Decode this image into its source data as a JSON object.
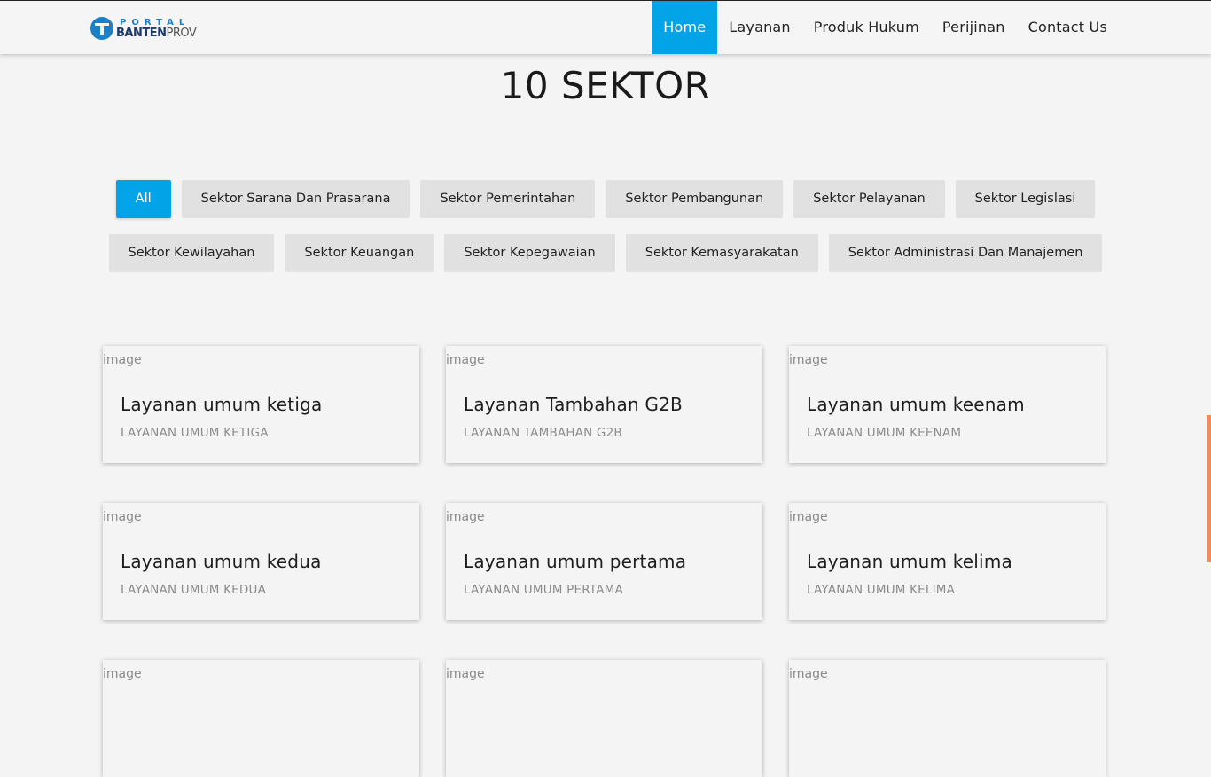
{
  "brand": {
    "top": "PORTAL",
    "bottom_bold": "BANTEN",
    "bottom_light": "PROV"
  },
  "nav": {
    "items": [
      {
        "label": "Home",
        "active": true
      },
      {
        "label": "Layanan"
      },
      {
        "label": "Produk Hukum"
      },
      {
        "label": "Perijinan"
      },
      {
        "label": "Contact Us"
      }
    ]
  },
  "section": {
    "title": "10 SEKTOR"
  },
  "filters": [
    {
      "label": "All",
      "active": true
    },
    {
      "label": "Sektor Sarana Dan Prasarana"
    },
    {
      "label": "Sektor Pemerintahan"
    },
    {
      "label": "Sektor Pembangunan"
    },
    {
      "label": "Sektor Pelayanan"
    },
    {
      "label": "Sektor Legislasi"
    },
    {
      "label": "Sektor Kewilayahan"
    },
    {
      "label": "Sektor Keuangan"
    },
    {
      "label": "Sektor Kepegawaian"
    },
    {
      "label": "Sektor Kemasyarakatan"
    },
    {
      "label": "Sektor Administrasi Dan Manajemen"
    }
  ],
  "cards": [
    {
      "image_alt": "image",
      "title": "Layanan umum ketiga",
      "subtitle": "LAYANAN UMUM KETIGA"
    },
    {
      "image_alt": "image",
      "title": "Layanan Tambahan G2B",
      "subtitle": "LAYANAN TAMBAHAN G2B"
    },
    {
      "image_alt": "image",
      "title": "Layanan umum keenam",
      "subtitle": "LAYANAN UMUM KEENAM"
    },
    {
      "image_alt": "image",
      "title": "Layanan umum kedua",
      "subtitle": "LAYANAN UMUM KEDUA"
    },
    {
      "image_alt": "image",
      "title": "Layanan umum pertama",
      "subtitle": "LAYANAN UMUM PERTAMA"
    },
    {
      "image_alt": "image",
      "title": "Layanan umum kelima",
      "subtitle": "LAYANAN UMUM KELIMA"
    },
    {
      "image_alt": "image",
      "title": "",
      "subtitle": ""
    },
    {
      "image_alt": "image",
      "title": "",
      "subtitle": ""
    },
    {
      "image_alt": "image",
      "title": "",
      "subtitle": ""
    }
  ],
  "colors": {
    "accent": "#03a3e8",
    "scroll_indicator": "#f08a5d",
    "brand_blue": "#1d7fc4"
  }
}
